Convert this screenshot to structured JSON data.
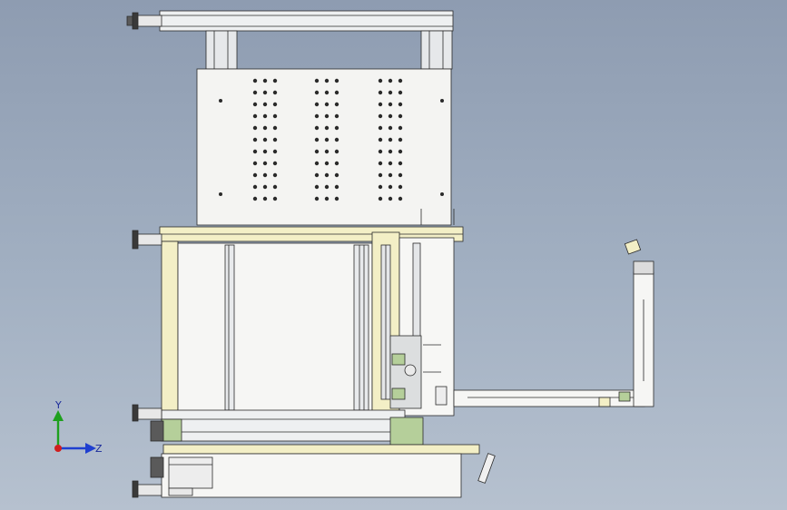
{
  "viewport": {
    "background_top": "#8e9cb1",
    "background_bottom": "#b6c1cf",
    "line_color": "#2a2a2a",
    "panel_fill": "#f4f4f2",
    "extrusion_fill": "#e6e8ea",
    "highlight_fill": "#f3efc6",
    "accent_green": "#b5cf9a"
  },
  "triad": {
    "y_label": "Y",
    "z_label": "Z",
    "y_color": "#1ea01e",
    "z_color": "#1f3fd0",
    "x_color": "#d01e1e"
  }
}
